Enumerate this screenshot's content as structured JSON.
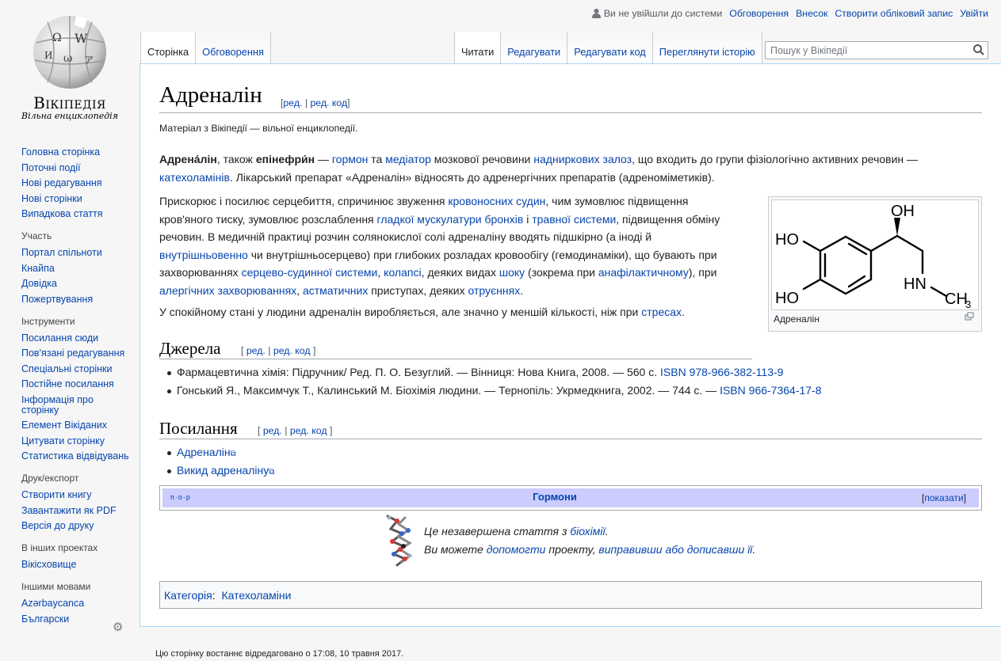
{
  "logo": {
    "title": "Вікіпедія",
    "subtitle": "Вільна енциклопедія"
  },
  "personal": {
    "not_logged": "Ви не увійшли до системи",
    "links": [
      "Обговорення",
      "Внесок",
      "Створити обліковий запис",
      "Увійти"
    ]
  },
  "tabs": {
    "left": [
      "Сторінка",
      "Обговорення"
    ],
    "right": [
      "Читати",
      "Редагувати",
      "Редагувати код",
      "Переглянути історію"
    ]
  },
  "search": {
    "placeholder": "Пошук у Вікіпедії"
  },
  "sidebar": {
    "main": [
      "Головна сторінка",
      "Поточні події",
      "Нові редагування",
      "Нові сторінки",
      "Випадкова стаття"
    ],
    "participation": {
      "title": "Участь",
      "items": [
        "Портал спільноти",
        "Кнайпа",
        "Довідка",
        "Пожертвування"
      ]
    },
    "tools": {
      "title": "Інструменти",
      "items": [
        "Посилання сюди",
        "Пов'язані редагування",
        "Спеціальні сторінки",
        "Постійне посилання",
        "Інформація про сторінку",
        "Елемент Вікіданих",
        "Цитувати сторінку",
        "Статистика відвідувань"
      ]
    },
    "print": {
      "title": "Друк/експорт",
      "items": [
        "Створити книгу",
        "Завантажити як PDF",
        "Версія до друку"
      ]
    },
    "projects": {
      "title": "В інших проектах",
      "items": [
        "Вікісховище"
      ]
    },
    "langs": {
      "title": "Іншими мовами",
      "items": [
        "Azərbaycanca",
        "Български"
      ]
    }
  },
  "article": {
    "title": "Адреналін",
    "edit": "ред.",
    "edit_code": "ред. код",
    "tagline": "Матеріал з Вікіпедії — вільної енциклопедії.",
    "p1": [
      {
        "b": "Адрена́лін"
      },
      {
        "t": ", також "
      },
      {
        "b": "епінефри́н"
      },
      {
        "t": " — "
      },
      {
        "a": "гормон"
      },
      {
        "t": " та "
      },
      {
        "a": "медіатор"
      },
      {
        "t": " мозкової речовини "
      },
      {
        "a": "надниркових залоз"
      },
      {
        "t": ", що входить до групи фізіологічно активних речовин — "
      },
      {
        "a": "катехоламінів"
      },
      {
        "t": ". Лікарський препарат «Адреналін» відносять до адренергічних препаратів (адреноміметиків)."
      }
    ],
    "p2": [
      {
        "t": "Прискорює і посилює серцебиття, спричинює звуження "
      },
      {
        "a": "кровоносних судин"
      },
      {
        "t": ", чим зумовлює підвищення кров'яного тиску, зумовлює розслаблення "
      },
      {
        "a": "гладкої мускулатури"
      },
      {
        "t": " "
      },
      {
        "a": "бронхів"
      },
      {
        "t": " і "
      },
      {
        "a": "травної системи"
      },
      {
        "t": ", підвищення обміну речовин. В медичній практиці розчин солянокислої солі адреналіну вводять підшкірно (а іноді й "
      },
      {
        "a": "внутрішньовенно"
      },
      {
        "t": " чи внутрішньосерцево) при глибоких розладах кровообігу (гемодинаміки), що бувають при захворюваннях "
      },
      {
        "a": "серцево-судинної системи"
      },
      {
        "t": ", "
      },
      {
        "a": "колапсі"
      },
      {
        "t": ", деяких видах "
      },
      {
        "a": "шоку"
      },
      {
        "t": " (зокрема при "
      },
      {
        "a": "анафілактичному"
      },
      {
        "t": "), при "
      },
      {
        "a": "алергічних захворюваннях"
      },
      {
        "t": ", "
      },
      {
        "a": "астматичних"
      },
      {
        "t": " приступах, деяких "
      },
      {
        "a": "отруєннях"
      },
      {
        "t": "."
      }
    ],
    "p3": [
      {
        "t": "У спокійному стані у людини адреналін виробляється, але значно у меншій кількості, ніж при "
      },
      {
        "a": "стресах"
      },
      {
        "t": "."
      }
    ],
    "image_caption": "Адреналін",
    "sources_title": "Джерела",
    "sources": [
      [
        {
          "t": "Фармацевтична хімія: Підручник/ Ред. П. О. Безуглий. — Вінниця: Нова Книга, 2008. — 560 с. "
        },
        {
          "a": "ISBN"
        },
        {
          "t": " "
        },
        {
          "a": "978-966-382-113-9"
        }
      ],
      [
        {
          "t": "Гонський Я., Максимчук Т., Калинський М. Біохімія людини. — Тернопіль: Укрмедкнига, 2002. — 744 с. — "
        },
        {
          "a": "ISBN"
        },
        {
          "t": " "
        },
        {
          "a": "966-7364-17-8"
        }
      ]
    ],
    "links_title": "Посилання",
    "links": [
      "Адреналін",
      "Викид адреналіну"
    ],
    "navbox": {
      "vde": "п·о·р",
      "title": "Гормони",
      "show": "показати"
    },
    "stub": {
      "line1": [
        {
          "t": "Це незавершена стаття з "
        },
        {
          "a": "біохімії"
        },
        {
          "t": "."
        }
      ],
      "line2": [
        {
          "t": "Ви можете "
        },
        {
          "a": "допомогти"
        },
        {
          "t": " проекту, "
        },
        {
          "a": "виправивши або дописавши її"
        },
        {
          "t": "."
        }
      ]
    },
    "categories_label": "Категорія",
    "categories": [
      "Катехоламіни"
    ]
  },
  "footer": {
    "last_edit": "Цю сторінку востаннє відредаговано о 17:08, 10 травня 2017."
  },
  "molecule": {
    "OH_top": "OH",
    "HO_upper": "HO",
    "HO_lower": "HO",
    "HN": "HN",
    "CH": "CH",
    "sub3": "3"
  }
}
